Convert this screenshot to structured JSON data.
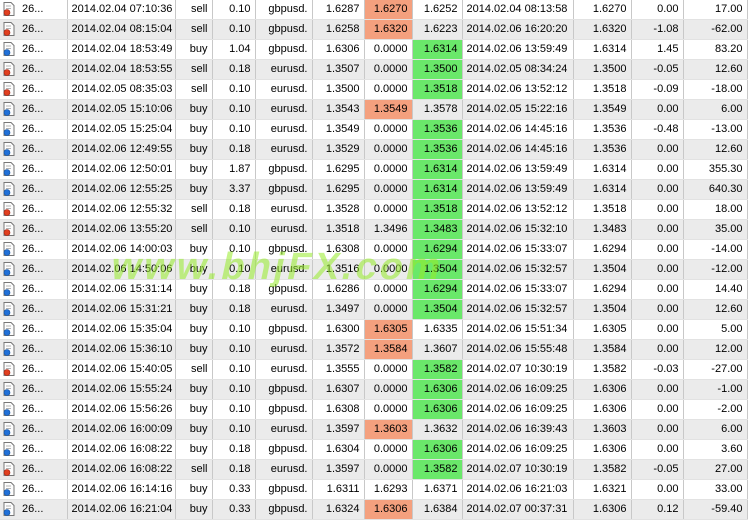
{
  "rows": [
    {
      "ticket": "26...",
      "open_time": "2014.02.04 07:10:36",
      "type": "sell",
      "size": "0.10",
      "symbol": "gbpusd.",
      "open_price": "1.6287",
      "sl": "1.6270",
      "tp": "1.6252",
      "close_time": "2014.02.04 08:13:58",
      "close_price": "1.6270",
      "swap": "0.00",
      "profit": "17.00",
      "hl": "sl-loss",
      "icon": "red"
    },
    {
      "ticket": "26...",
      "open_time": "2014.02.04 08:15:04",
      "type": "sell",
      "size": "0.10",
      "symbol": "gbpusd.",
      "open_price": "1.6258",
      "sl": "1.6320",
      "tp": "1.6223",
      "close_time": "2014.02.06 16:20:20",
      "close_price": "1.6320",
      "swap": "-1.08",
      "profit": "-62.00",
      "hl": "sl-loss",
      "icon": "red"
    },
    {
      "ticket": "26...",
      "open_time": "2014.02.04 18:53:49",
      "type": "buy",
      "size": "1.04",
      "symbol": "gbpusd.",
      "open_price": "1.6306",
      "sl": "0.0000",
      "tp": "1.6314",
      "close_time": "2014.02.06 13:59:49",
      "close_price": "1.6314",
      "swap": "1.45",
      "profit": "83.20",
      "hl": "tp-win",
      "icon": "blue"
    },
    {
      "ticket": "26...",
      "open_time": "2014.02.04 18:53:55",
      "type": "sell",
      "size": "0.18",
      "symbol": "eurusd.",
      "open_price": "1.3507",
      "sl": "0.0000",
      "tp": "1.3500",
      "close_time": "2014.02.05 08:34:24",
      "close_price": "1.3500",
      "swap": "-0.05",
      "profit": "12.60",
      "hl": "tp-win",
      "icon": "red"
    },
    {
      "ticket": "26...",
      "open_time": "2014.02.05 08:35:03",
      "type": "sell",
      "size": "0.10",
      "symbol": "eurusd.",
      "open_price": "1.3500",
      "sl": "0.0000",
      "tp": "1.3518",
      "close_time": "2014.02.06 13:52:12",
      "close_price": "1.3518",
      "swap": "-0.09",
      "profit": "-18.00",
      "hl": "tp-win",
      "icon": "red"
    },
    {
      "ticket": "26...",
      "open_time": "2014.02.05 15:10:06",
      "type": "buy",
      "size": "0.10",
      "symbol": "eurusd.",
      "open_price": "1.3543",
      "sl": "1.3549",
      "tp": "1.3578",
      "close_time": "2014.02.05 15:22:16",
      "close_price": "1.3549",
      "swap": "0.00",
      "profit": "6.00",
      "hl": "sl-loss",
      "icon": "blue"
    },
    {
      "ticket": "26...",
      "open_time": "2014.02.05 15:25:04",
      "type": "buy",
      "size": "0.10",
      "symbol": "eurusd.",
      "open_price": "1.3549",
      "sl": "0.0000",
      "tp": "1.3536",
      "close_time": "2014.02.06 14:45:16",
      "close_price": "1.3536",
      "swap": "-0.48",
      "profit": "-13.00",
      "hl": "tp-win",
      "icon": "blue"
    },
    {
      "ticket": "26...",
      "open_time": "2014.02.06 12:49:55",
      "type": "buy",
      "size": "0.18",
      "symbol": "eurusd.",
      "open_price": "1.3529",
      "sl": "0.0000",
      "tp": "1.3536",
      "close_time": "2014.02.06 14:45:16",
      "close_price": "1.3536",
      "swap": "0.00",
      "profit": "12.60",
      "hl": "tp-win",
      "icon": "blue"
    },
    {
      "ticket": "26...",
      "open_time": "2014.02.06 12:50:01",
      "type": "buy",
      "size": "1.87",
      "symbol": "gbpusd.",
      "open_price": "1.6295",
      "sl": "0.0000",
      "tp": "1.6314",
      "close_time": "2014.02.06 13:59:49",
      "close_price": "1.6314",
      "swap": "0.00",
      "profit": "355.30",
      "hl": "tp-win",
      "icon": "blue"
    },
    {
      "ticket": "26...",
      "open_time": "2014.02.06 12:55:25",
      "type": "buy",
      "size": "3.37",
      "symbol": "gbpusd.",
      "open_price": "1.6295",
      "sl": "0.0000",
      "tp": "1.6314",
      "close_time": "2014.02.06 13:59:49",
      "close_price": "1.6314",
      "swap": "0.00",
      "profit": "640.30",
      "hl": "tp-win",
      "icon": "blue"
    },
    {
      "ticket": "26...",
      "open_time": "2014.02.06 12:55:32",
      "type": "sell",
      "size": "0.18",
      "symbol": "eurusd.",
      "open_price": "1.3528",
      "sl": "0.0000",
      "tp": "1.3518",
      "close_time": "2014.02.06 13:52:12",
      "close_price": "1.3518",
      "swap": "0.00",
      "profit": "18.00",
      "hl": "tp-win",
      "icon": "red"
    },
    {
      "ticket": "26...",
      "open_time": "2014.02.06 13:55:20",
      "type": "sell",
      "size": "0.10",
      "symbol": "eurusd.",
      "open_price": "1.3518",
      "sl": "1.3496",
      "tp": "1.3483",
      "close_time": "2014.02.06 15:32:10",
      "close_price": "1.3483",
      "swap": "0.00",
      "profit": "35.00",
      "hl": "tp-win",
      "icon": "red"
    },
    {
      "ticket": "26...",
      "open_time": "2014.02.06 14:00:03",
      "type": "buy",
      "size": "0.10",
      "symbol": "gbpusd.",
      "open_price": "1.6308",
      "sl": "0.0000",
      "tp": "1.6294",
      "close_time": "2014.02.06 15:33:07",
      "close_price": "1.6294",
      "swap": "0.00",
      "profit": "-14.00",
      "hl": "tp-win",
      "icon": "blue"
    },
    {
      "ticket": "26...",
      "open_time": "2014.02.06 14:50:06",
      "type": "buy",
      "size": "0.10",
      "symbol": "eurusd.",
      "open_price": "1.3516",
      "sl": "0.0000",
      "tp": "1.3504",
      "close_time": "2014.02.06 15:32:57",
      "close_price": "1.3504",
      "swap": "0.00",
      "profit": "-12.00",
      "hl": "tp-win",
      "icon": "blue"
    },
    {
      "ticket": "26...",
      "open_time": "2014.02.06 15:31:14",
      "type": "buy",
      "size": "0.18",
      "symbol": "gbpusd.",
      "open_price": "1.6286",
      "sl": "0.0000",
      "tp": "1.6294",
      "close_time": "2014.02.06 15:33:07",
      "close_price": "1.6294",
      "swap": "0.00",
      "profit": "14.40",
      "hl": "tp-win",
      "icon": "blue"
    },
    {
      "ticket": "26...",
      "open_time": "2014.02.06 15:31:21",
      "type": "buy",
      "size": "0.18",
      "symbol": "eurusd.",
      "open_price": "1.3497",
      "sl": "0.0000",
      "tp": "1.3504",
      "close_time": "2014.02.06 15:32:57",
      "close_price": "1.3504",
      "swap": "0.00",
      "profit": "12.60",
      "hl": "tp-win",
      "icon": "blue"
    },
    {
      "ticket": "26...",
      "open_time": "2014.02.06 15:35:04",
      "type": "buy",
      "size": "0.10",
      "symbol": "gbpusd.",
      "open_price": "1.6300",
      "sl": "1.6305",
      "tp": "1.6335",
      "close_time": "2014.02.06 15:51:34",
      "close_price": "1.6305",
      "swap": "0.00",
      "profit": "5.00",
      "hl": "sl-loss",
      "icon": "blue"
    },
    {
      "ticket": "26...",
      "open_time": "2014.02.06 15:36:10",
      "type": "buy",
      "size": "0.10",
      "symbol": "eurusd.",
      "open_price": "1.3572",
      "sl": "1.3584",
      "tp": "1.3607",
      "close_time": "2014.02.06 15:55:48",
      "close_price": "1.3584",
      "swap": "0.00",
      "profit": "12.00",
      "hl": "sl-loss",
      "icon": "blue"
    },
    {
      "ticket": "26...",
      "open_time": "2014.02.06 15:40:05",
      "type": "sell",
      "size": "0.10",
      "symbol": "eurusd.",
      "open_price": "1.3555",
      "sl": "0.0000",
      "tp": "1.3582",
      "close_time": "2014.02.07 10:30:19",
      "close_price": "1.3582",
      "swap": "-0.03",
      "profit": "-27.00",
      "hl": "tp-win",
      "icon": "red"
    },
    {
      "ticket": "26...",
      "open_time": "2014.02.06 15:55:24",
      "type": "buy",
      "size": "0.10",
      "symbol": "gbpusd.",
      "open_price": "1.6307",
      "sl": "0.0000",
      "tp": "1.6306",
      "close_time": "2014.02.06 16:09:25",
      "close_price": "1.6306",
      "swap": "0.00",
      "profit": "-1.00",
      "hl": "tp-win",
      "icon": "blue"
    },
    {
      "ticket": "26...",
      "open_time": "2014.02.06 15:56:26",
      "type": "buy",
      "size": "0.10",
      "symbol": "gbpusd.",
      "open_price": "1.6308",
      "sl": "0.0000",
      "tp": "1.6306",
      "close_time": "2014.02.06 16:09:25",
      "close_price": "1.6306",
      "swap": "0.00",
      "profit": "-2.00",
      "hl": "tp-win",
      "icon": "blue"
    },
    {
      "ticket": "26...",
      "open_time": "2014.02.06 16:00:09",
      "type": "buy",
      "size": "0.10",
      "symbol": "eurusd.",
      "open_price": "1.3597",
      "sl": "1.3603",
      "tp": "1.3632",
      "close_time": "2014.02.06 16:39:43",
      "close_price": "1.3603",
      "swap": "0.00",
      "profit": "6.00",
      "hl": "sl-loss",
      "icon": "blue"
    },
    {
      "ticket": "26...",
      "open_time": "2014.02.06 16:08:22",
      "type": "buy",
      "size": "0.18",
      "symbol": "gbpusd.",
      "open_price": "1.6304",
      "sl": "0.0000",
      "tp": "1.6306",
      "close_time": "2014.02.06 16:09:25",
      "close_price": "1.6306",
      "swap": "0.00",
      "profit": "3.60",
      "hl": "tp-win",
      "icon": "blue"
    },
    {
      "ticket": "26...",
      "open_time": "2014.02.06 16:08:22",
      "type": "sell",
      "size": "0.18",
      "symbol": "eurusd.",
      "open_price": "1.3597",
      "sl": "0.0000",
      "tp": "1.3582",
      "close_time": "2014.02.07 10:30:19",
      "close_price": "1.3582",
      "swap": "-0.05",
      "profit": "27.00",
      "hl": "tp-win",
      "icon": "red"
    },
    {
      "ticket": "26...",
      "open_time": "2014.02.06 16:14:16",
      "type": "buy",
      "size": "0.33",
      "symbol": "gbpusd.",
      "open_price": "1.6311",
      "sl": "1.6293",
      "tp": "1.6371",
      "close_time": "2014.02.06 16:21:03",
      "close_price": "1.6321",
      "swap": "0.00",
      "profit": "33.00",
      "hl": "none",
      "icon": "blue"
    },
    {
      "ticket": "26...",
      "open_time": "2014.02.06 16:21:04",
      "type": "buy",
      "size": "0.33",
      "symbol": "gbpusd.",
      "open_price": "1.6324",
      "sl": "1.6306",
      "tp": "1.6384",
      "close_time": "2014.02.07 00:37:31",
      "close_price": "1.6306",
      "swap": "0.12",
      "profit": "-59.40",
      "hl": "sl-loss",
      "icon": "blue"
    }
  ],
  "watermark": "www.bhjFX.com",
  "colors": {
    "loss_highlight": "#f4a07e",
    "win_highlight": "#6ae86a",
    "row_even": "#ffffff",
    "row_odd": "#ebebeb"
  }
}
